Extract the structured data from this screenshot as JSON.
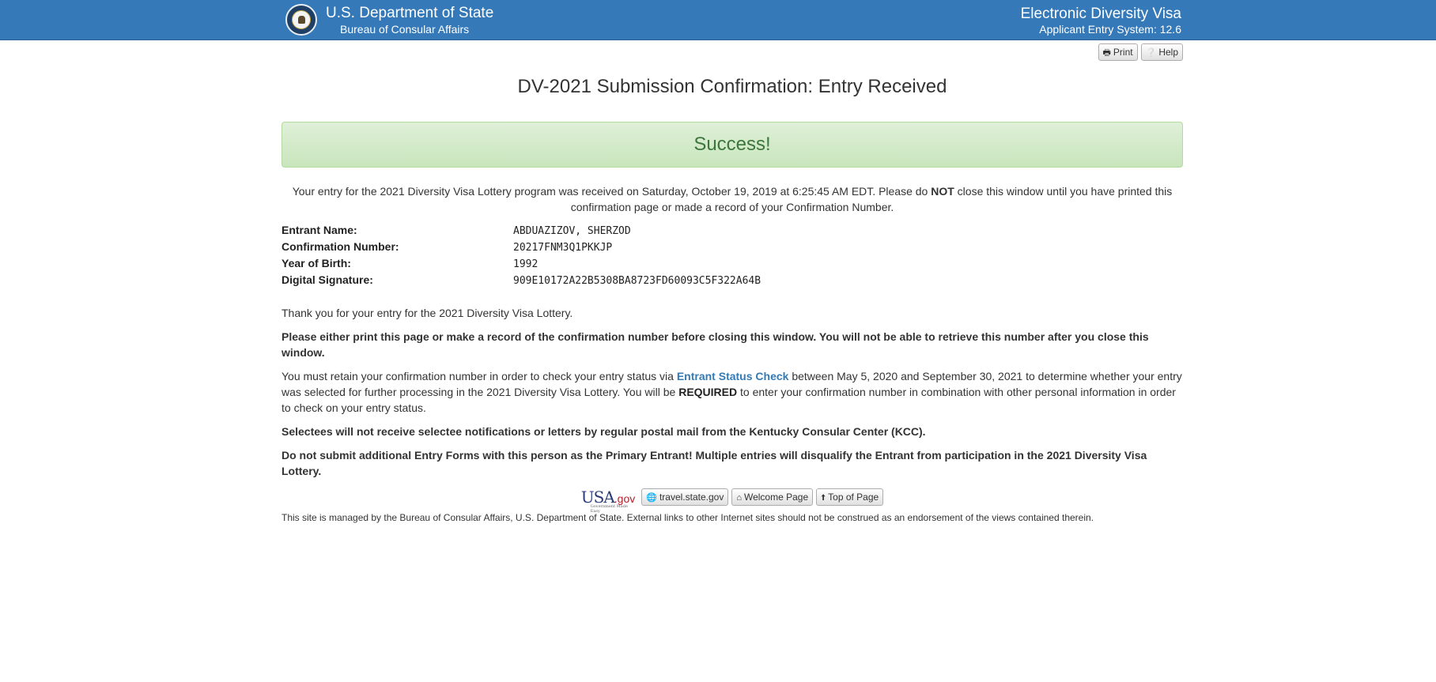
{
  "header": {
    "dept_title": "U.S. Department of State",
    "dept_sub": "Bureau of Consular Affairs",
    "app_title": "Electronic Diversity Visa",
    "app_sub": "Applicant Entry System: 12.6",
    "seal_icon": "department-of-state-seal",
    "bar_color": "#3579b8"
  },
  "toolbar": {
    "print_label": "Print",
    "help_label": "Help",
    "print_icon": "printer-icon",
    "help_icon": "question-circle-icon"
  },
  "page_title": "DV-2021 Submission Confirmation: Entry Received",
  "alert": {
    "text": "Success!",
    "color": "#3c763d",
    "background": "#dff0d8"
  },
  "received": {
    "before": "Your entry for the 2021 Diversity Visa Lottery program was received on Saturday, October 19, 2019 at 6:25:45 AM EDT. Please do ",
    "bold": "NOT",
    "after": " close this window until you have printed this confirmation page or made a record of your Confirmation Number."
  },
  "entry_info": [
    {
      "label": "Entrant Name:",
      "value": "ABDUAZIZOV, SHERZOD"
    },
    {
      "label": "Confirmation Number:",
      "value": "20217FNM3Q1PKKJP"
    },
    {
      "label": "Year of Birth:",
      "value": "1992"
    },
    {
      "label": "Digital Signature:",
      "value": "909E10172A22B5308BA8723FD60093C5F322A64B"
    }
  ],
  "paragraphs": {
    "thanks": "Thank you for your entry for the 2021 Diversity Visa Lottery.",
    "print_warning": "Please either print this page or make a record of the confirmation number before closing this window. You will not be able to retrieve this number after you close this window.",
    "retain_before": "You must retain your confirmation number in order to check your entry status via ",
    "retain_link": "Entrant Status Check",
    "retain_middle": " between May 5, 2020 and September 30, 2021 to determine whether your entry was selected for further processing in the 2021 Diversity Visa Lottery. You will be ",
    "retain_bold": "REQUIRED",
    "retain_after": " to enter your confirmation number in combination with other personal information in order to check on your entry status.",
    "selectees": "Selectees will not receive selectee notifications or letters by regular postal mail from the Kentucky Consular Center (KCC).",
    "do_not_submit": "Do not submit additional Entry Forms with this person as the Primary Entrant! Multiple entries will disqualify the Entrant from participation in the 2021 Diversity Visa Lottery."
  },
  "footer": {
    "usagov_main": "USA",
    "usagov_suffix": ".gov",
    "usagov_tag": "Government Made Easy",
    "travel_label": "travel.state.gov",
    "welcome_label": "Welcome Page",
    "top_label": "Top of Page",
    "travel_icon": "globe-icon",
    "welcome_icon": "home-icon",
    "top_icon": "arrow-up-icon",
    "disclaimer": "This site is managed by the Bureau of Consular Affairs, U.S. Department of State. External links to other Internet sites should not be construed as an endorsement of the views contained therein."
  }
}
